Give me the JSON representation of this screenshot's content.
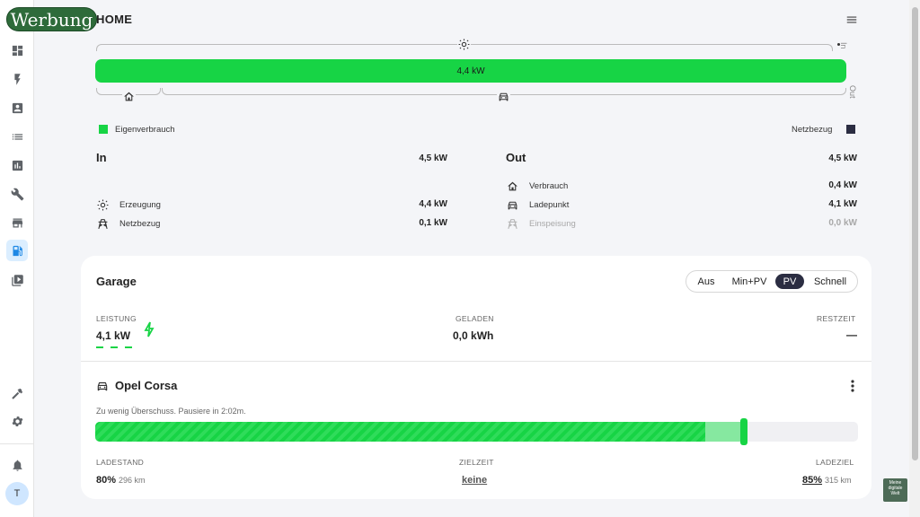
{
  "watermark": "Werbung",
  "page": {
    "title": "HOME"
  },
  "flow": {
    "side_in": "In",
    "side_out": "Out",
    "bar_label": "4,4 kW",
    "bar_color": "#17d445"
  },
  "legend": {
    "self_label": "Eigenverbrauch",
    "self_color": "#17d445",
    "grid_label": "Netzbezug",
    "grid_color": "#2b2d42"
  },
  "in": {
    "title": "In",
    "total": "4,5 kW",
    "rows": [
      {
        "icon": "sun-icon",
        "label": "Erzeugung",
        "value": "4,4 kW"
      },
      {
        "icon": "power-tower-icon",
        "label": "Netzbezug",
        "value": "0,1 kW"
      }
    ]
  },
  "out": {
    "title": "Out",
    "total": "4,5 kW",
    "rows": [
      {
        "icon": "house-icon",
        "label": "Verbrauch",
        "value": "0,4 kW"
      },
      {
        "icon": "car-icon",
        "label": "Ladepunkt",
        "value": "4,1 kW"
      },
      {
        "icon": "power-tower-icon",
        "label": "Einspeisung",
        "value": "0,0 kW"
      }
    ]
  },
  "garage": {
    "title": "Garage",
    "modes": [
      "Aus",
      "Min+PV",
      "PV",
      "Schnell"
    ],
    "active_mode": "PV",
    "power_label": "LEISTUNG",
    "power_value": "4,1 kW",
    "charged_label": "GELADEN",
    "charged_value": "0,0 kWh",
    "remaining_label": "RESTZEIT",
    "remaining_value": "—"
  },
  "vehicle": {
    "name": "Opel Corsa",
    "status": "Zu wenig Überschuss. Pausiere in 2:02m.",
    "soc_percent": 80,
    "target_percent": 85,
    "soc_label": "LADESTAND",
    "soc_value": "80%",
    "soc_range": "296 km",
    "time_label": "ZIELZEIT",
    "time_value": "keine",
    "target_label": "LADEZIEL",
    "target_value": "85%",
    "target_range": "315 km"
  },
  "user": {
    "initial": "T"
  },
  "badge_text": "Meine digitale Welt"
}
